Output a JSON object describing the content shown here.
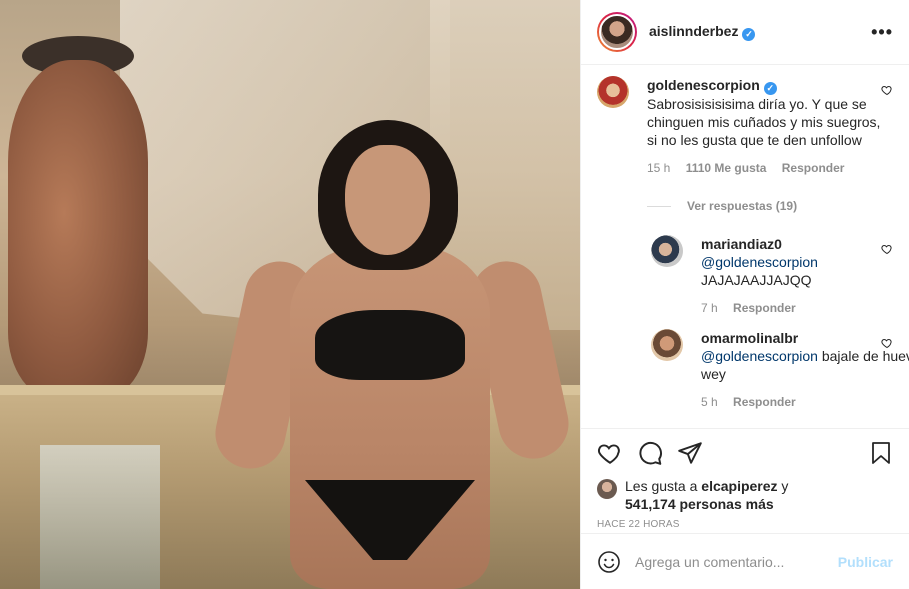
{
  "post": {
    "author": "aislinnderbez",
    "author_verified": true
  },
  "comments": [
    {
      "user": "goldenescorpion",
      "verified": true,
      "text": "Sabrosisisisisima diría yo. Y que se chinguen mis cuñados y mis suegros, si no les gusta que te den unfollow",
      "time": "15 h",
      "likes": "1110 Me gusta",
      "reply_label": "Responder",
      "view_replies": "Ver respuestas (19)"
    }
  ],
  "replies": [
    {
      "user": "mariandiaz0",
      "mention": "@goldenescorpion",
      "text": "JAJAJAAJJAJQQ",
      "time": "7 h",
      "reply_label": "Responder"
    },
    {
      "user": "omarmolinalbr",
      "mention": "@goldenescorpion",
      "text": " bajale de huevos wey",
      "time": "5 h",
      "reply_label": "Responder"
    }
  ],
  "likes": {
    "prefix": "Les gusta a ",
    "user": "elcapiperez",
    "suffix": " y",
    "count": "541,174 personas más"
  },
  "timestamp": "HACE 22 HORAS",
  "add_comment": {
    "placeholder": "Agrega un comentario...",
    "publish_label": "Publicar"
  },
  "colors": {
    "verified": "#3897f0",
    "link": "#00376b",
    "muted": "#8e8e8e",
    "publish_disabled": "#b2dffc"
  }
}
